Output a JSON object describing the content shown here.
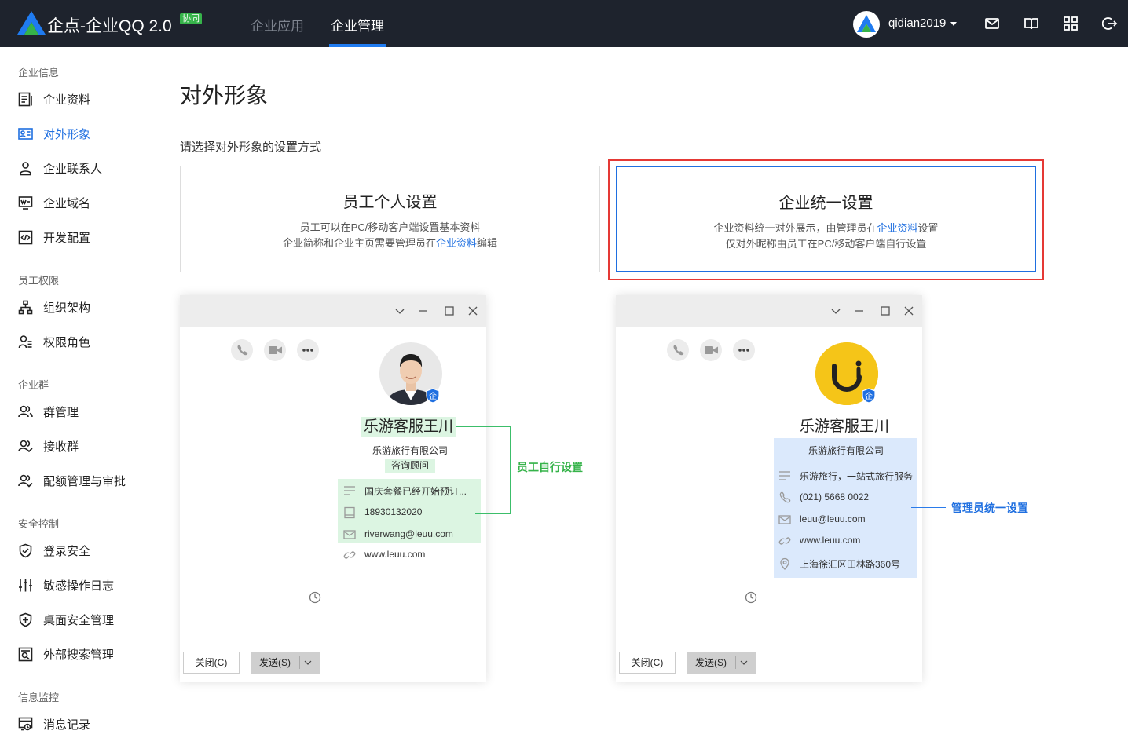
{
  "topbar": {
    "brand": "企点-企业QQ 2.0",
    "brand_tag": "协同",
    "tabs": [
      {
        "label": "企业应用",
        "active": false
      },
      {
        "label": "企业管理",
        "active": true
      }
    ],
    "username": "qidian2019",
    "icons": [
      "mail-icon",
      "book-icon",
      "apps-grid-icon",
      "logout-icon"
    ]
  },
  "sidebar": {
    "groups": [
      {
        "label": "企业信息",
        "items": [
          {
            "label": "企业资料",
            "icon": "profile-icon"
          },
          {
            "label": "对外形象",
            "icon": "id-card-icon",
            "active": true
          },
          {
            "label": "企业联系人",
            "icon": "contact-icon"
          },
          {
            "label": "企业域名",
            "icon": "domain-icon"
          },
          {
            "label": "开发配置",
            "icon": "code-icon"
          }
        ]
      },
      {
        "label": "员工权限",
        "items": [
          {
            "label": "组织架构",
            "icon": "org-chart-icon"
          },
          {
            "label": "权限角色",
            "icon": "role-icon"
          }
        ]
      },
      {
        "label": "企业群",
        "items": [
          {
            "label": "群管理",
            "icon": "group-icon"
          },
          {
            "label": "接收群",
            "icon": "receive-group-icon"
          },
          {
            "label": "配额管理与审批",
            "icon": "quota-icon"
          }
        ]
      },
      {
        "label": "安全控制",
        "items": [
          {
            "label": "登录安全",
            "icon": "shield-check-icon"
          },
          {
            "label": "敏感操作日志",
            "icon": "sliders-icon"
          },
          {
            "label": "桌面安全管理",
            "icon": "shield-plus-icon"
          },
          {
            "label": "外部搜索管理",
            "icon": "search-box-icon"
          }
        ]
      },
      {
        "label": "信息监控",
        "items": [
          {
            "label": "消息记录",
            "icon": "message-log-icon"
          }
        ]
      }
    ]
  },
  "main": {
    "title": "对外形象",
    "prompt": "请选择对外形象的设置方式",
    "options": [
      {
        "title": "员工个人设置",
        "line1": "员工可以在PC/移动客户端设置基本资料",
        "line2_pre": "企业简称和企业主页需要管理员在",
        "line2_link": "企业资料",
        "line2_post": "编辑",
        "selected": false
      },
      {
        "title": "企业统一设置",
        "line1_pre": "企业资料统一对外展示，由管理员在",
        "line1_link": "企业资料",
        "line1_post": "设置",
        "line2": "仅对外昵称由员工在PC/移动客户端自行设置",
        "selected": true
      }
    ]
  },
  "preview_left": {
    "name": "乐游客服王川",
    "company": "乐游旅行有限公司",
    "title": "咨询顾问",
    "badge": "企",
    "info": [
      {
        "icon": "lines-icon",
        "text": "国庆套餐已经开始预订..."
      },
      {
        "icon": "phone-mobile-icon",
        "text": "18930132020"
      },
      {
        "icon": "mail-icon",
        "text": "riverwang@leuu.com"
      },
      {
        "icon": "link-icon",
        "text": "www.leuu.com"
      }
    ],
    "callout": "员工自行设置",
    "close_btn": "关闭(C)",
    "send_btn": "发送(S)"
  },
  "preview_right": {
    "name": "乐游客服王川",
    "company": "乐游旅行有限公司",
    "badge": "企",
    "info": [
      {
        "icon": "lines-icon",
        "text": "乐游旅行，一站式旅行服务"
      },
      {
        "icon": "phone-icon",
        "text": "(021) 5668 0022"
      },
      {
        "icon": "mail-icon",
        "text": "leuu@leuu.com"
      },
      {
        "icon": "link-icon",
        "text": "www.leuu.com"
      },
      {
        "icon": "location-icon",
        "text": "上海徐汇区田林路360号"
      }
    ],
    "callout": "管理员统一设置",
    "close_btn": "关闭(C)",
    "send_btn": "发送(S)"
  },
  "colors": {
    "accent": "#1f6fe0",
    "green": "#3cbe6a",
    "red": "#e53935",
    "topbar": "#1e232d"
  }
}
